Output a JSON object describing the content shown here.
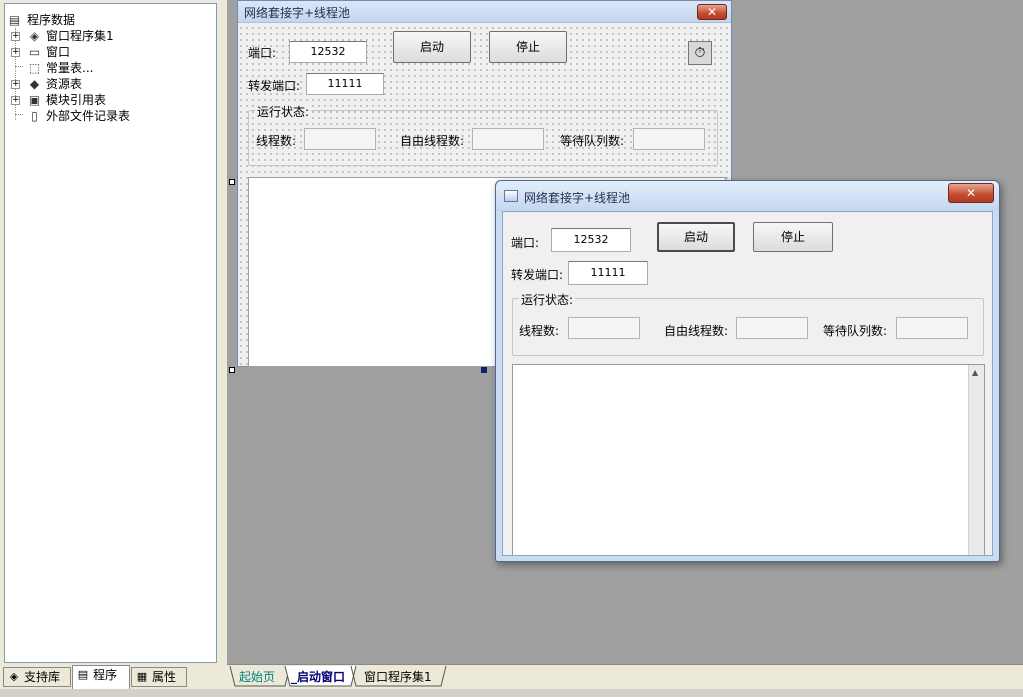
{
  "tree": {
    "root": "程序数据",
    "items": [
      {
        "label": "窗口程序集1",
        "icon": "layers-icon",
        "expander": "+"
      },
      {
        "label": "窗口",
        "icon": "window-icon",
        "expander": "+"
      },
      {
        "label": "常量表...",
        "icon": "cube-icon",
        "expander": ""
      },
      {
        "label": "资源表",
        "icon": "resource-icon",
        "expander": "+"
      },
      {
        "label": "模块引用表",
        "icon": "module-icon",
        "expander": "+"
      },
      {
        "label": "外部文件记录表",
        "icon": "document-icon",
        "expander": ""
      }
    ]
  },
  "left_tabs": {
    "support": "支持库",
    "program": "程序",
    "properties": "属性"
  },
  "design_form": {
    "title": "网络套接字+线程池",
    "close_glyph": "✕",
    "port_label": "端口:",
    "port_value": "12532",
    "start_button": "启动",
    "stop_button": "停止",
    "forward_label": "转发端口:",
    "forward_value": "11111",
    "status_group": "运行状态:",
    "threads_label": "线程数:",
    "free_threads_label": "自由线程数:",
    "queue_label": "等待队列数:",
    "timer_glyph": "⏱"
  },
  "preview_window": {
    "title": "网络套接字+线程池",
    "close_glyph": "✕",
    "port_label": "端口:",
    "port_value": "12532",
    "start_button": "启动",
    "stop_button": "停止",
    "forward_label": "转发端口:",
    "forward_value": "11111",
    "status_group": "运行状态:",
    "threads_label": "线程数:",
    "free_threads_label": "自由线程数:",
    "queue_label": "等待队列数:",
    "scroll_up_glyph": "▲"
  },
  "bottom_tabs": {
    "start_page": "起始页",
    "startup_window": "_启动窗口",
    "window_assembly": "窗口程序集1"
  },
  "colors": {
    "bottom_tab_start_page": "#008080",
    "bottom_tab_active": "#00007a"
  }
}
